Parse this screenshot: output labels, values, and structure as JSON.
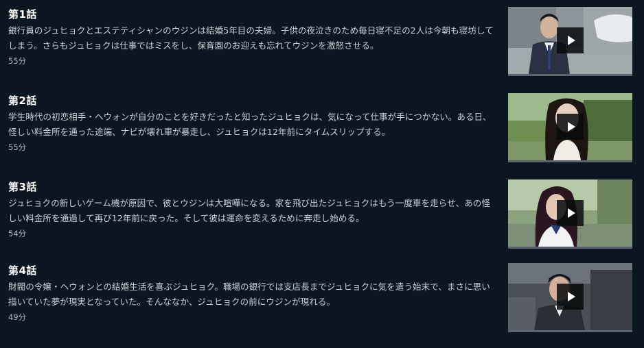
{
  "episodes": [
    {
      "title": "第1話",
      "description": "銀行員のジュヒョクとエステティシャンのウジンは結婚5年目の夫婦。子供の夜泣きのため毎日寝不足の2人は今朝も寝坊してしまう。さらもジュヒョクは仕事ではミスをし、保育園のお迎えも忘れてウジンを激怒させる。",
      "duration": "55分"
    },
    {
      "title": "第2話",
      "description": "学生時代の初恋相手・ヘウォンが自分のことを好きだったと知ったジュヒョクは、気になって仕事が手につかない。ある日、怪しい料金所を通った途端、ナビが壊れ車が暴走し、ジュヒョクは12年前にタイムスリップする。",
      "duration": "55分"
    },
    {
      "title": "第3話",
      "description": "ジュヒョクの新しいゲーム機が原因で、彼とウジンは大喧嘩になる。家を飛び出たジュヒョクはもう一度車を走らせ、あの怪しい料金所を通過して再び12年前に戻った。そして彼は運命を変えるために奔走し始める。",
      "duration": "54分"
    },
    {
      "title": "第4話",
      "description": "財閥の令嬢・ヘウォンとの結婚生活を喜ぶジュヒョク。職場の銀行では支店長までジュヒョクに気を遣う始末で、まさに思い描いていた夢が現実となっていた。そんななか、ジュヒョクの前にウジンが現れる。",
      "duration": "49分"
    }
  ],
  "colors": {
    "background": "#0b1620",
    "title": "#ffffff",
    "description": "#c9d1d8",
    "duration": "#aeb8c1",
    "thumb_underline": "#5b6570"
  },
  "icons": {
    "play": "play-icon"
  }
}
